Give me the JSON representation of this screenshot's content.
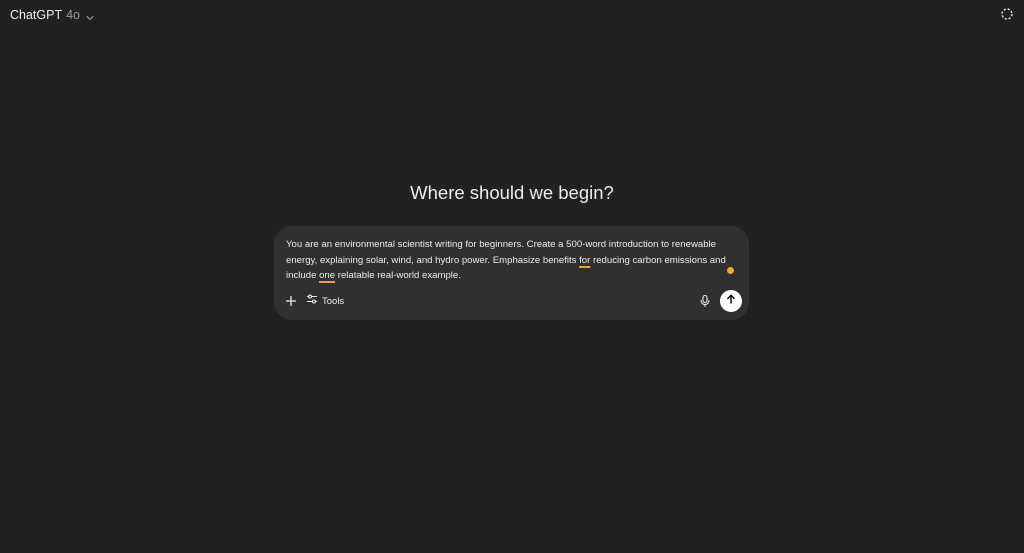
{
  "header": {
    "model_name": "ChatGPT",
    "model_version": "4o",
    "model_icon": "chevron-down-icon",
    "temp_chat_icon": "dashed-circle-icon"
  },
  "main": {
    "heading": "Where should we begin?"
  },
  "composer": {
    "prompt_parts": {
      "p1": "You are an environmental scientist writing for beginners. Create a 500-word introduction to renewable energy, explaining solar, wind, and hydro power. Emphasize benefits ",
      "w1": "for",
      "p2": " reducing carbon emissions and include ",
      "w2": "one",
      "p3": " relatable real-world example."
    },
    "tools_label": "Tools",
    "plus_icon": "plus-icon",
    "tools_icon": "sliders-icon",
    "mic_icon": "microphone-icon",
    "send_icon": "arrow-up-icon"
  },
  "colors": {
    "background": "#212121",
    "composer_bg": "#303030",
    "text": "#ececec",
    "muted": "#9b9b9b",
    "spellcheck": "#e8a33d",
    "grammar_dot": "#f0a63a",
    "send_bg": "#ffffff"
  }
}
